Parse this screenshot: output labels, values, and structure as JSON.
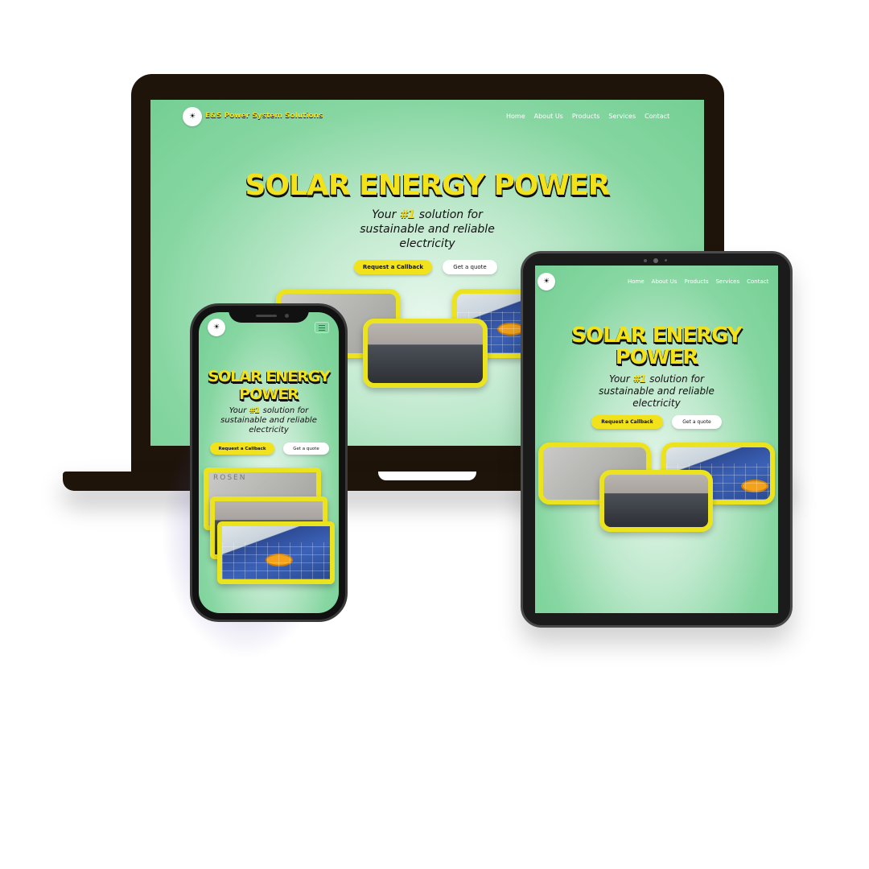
{
  "site": {
    "brand": "E&S Power System Solutions",
    "nav": [
      "Home",
      "About Us",
      "Products",
      "Services",
      "Contact"
    ],
    "hero_title": "SOLAR ENERGY POWER",
    "hero_line1": "SOLAR ENERGY",
    "hero_line2": "POWER",
    "tagline_prefix": "Your ",
    "tagline_hash": "#1",
    "tagline_rest": " solution for",
    "tagline_line2": "sustainable and reliable",
    "tagline_line3": "electricity",
    "cta_primary": "Request a Callback",
    "cta_secondary": "Get a quote",
    "menu_icon": "hamburger-icon",
    "phone_photo_text": "ROSEN"
  },
  "colors": {
    "accent_yellow": "#f2e21b",
    "site_green": "#74cf94",
    "device_dark": "#1e140a"
  }
}
